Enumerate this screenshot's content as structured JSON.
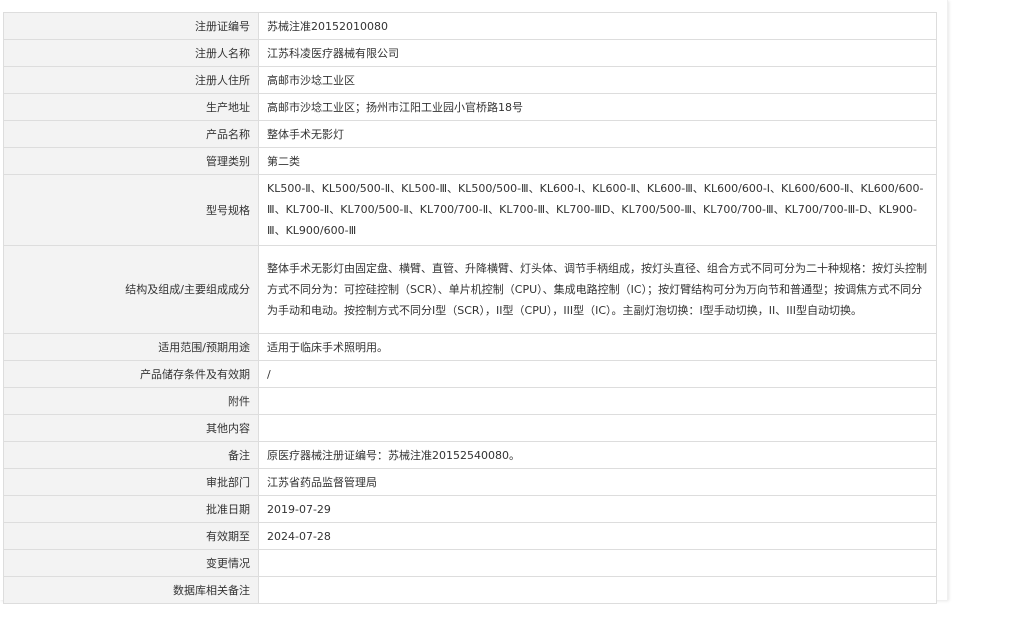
{
  "rows": [
    {
      "label": "注册证编号",
      "value": "苏械注准20152010080"
    },
    {
      "label": "注册人名称",
      "value": "江苏科凌医疗器械有限公司"
    },
    {
      "label": "注册人住所",
      "value": "高邮市沙埝工业区"
    },
    {
      "label": "生产地址",
      "value": "高邮市沙埝工业区；扬州市江阳工业园小官桥路18号"
    },
    {
      "label": "产品名称",
      "value": "整体手术无影灯"
    },
    {
      "label": "管理类别",
      "value": "第二类"
    },
    {
      "label": "型号规格",
      "value": "KL500-Ⅱ、KL500/500-Ⅱ、KL500-Ⅲ、KL500/500-Ⅲ、KL600-Ⅰ、KL600-Ⅱ、KL600-Ⅲ、KL600/600-Ⅰ、KL600/600-Ⅱ、KL600/600-Ⅲ、KL700-Ⅱ、KL700/500-Ⅱ、KL700/700-Ⅱ、KL700-Ⅲ、KL700-ⅢD、KL700/500-Ⅲ、KL700/700-Ⅲ、KL700/700-Ⅲ-D、KL900-Ⅲ、KL900/600-Ⅲ"
    },
    {
      "label": "结构及组成/主要组成成分",
      "value": "整体手术无影灯由固定盘、横臂、直管、升降横臂、灯头体、调节手柄组成，按灯头直径、组合方式不同可分为二十种规格：按灯头控制方式不同分为：可控硅控制（SCR）、单片机控制（CPU）、集成电路控制（IC）；按灯臂结构可分为万向节和普通型；按调焦方式不同分为手动和电动。按控制方式不同分I型（SCR），II型（CPU），III型（IC）。主副灯泡切换：I型手动切换，II、III型自动切换。"
    },
    {
      "label": "适用范围/预期用途",
      "value": "适用于临床手术照明用。"
    },
    {
      "label": "产品储存条件及有效期",
      "value": "/"
    },
    {
      "label": "附件",
      "value": ""
    },
    {
      "label": "其他内容",
      "value": ""
    },
    {
      "label": "备注",
      "value": "原医疗器械注册证编号：苏械注准20152540080。"
    },
    {
      "label": "审批部门",
      "value": "江苏省药品监督管理局"
    },
    {
      "label": "批准日期",
      "value": "2019-07-29"
    },
    {
      "label": "有效期至",
      "value": "2024-07-28"
    },
    {
      "label": "变更情况",
      "value": ""
    },
    {
      "label": "数据库相关备注",
      "value": ""
    }
  ]
}
